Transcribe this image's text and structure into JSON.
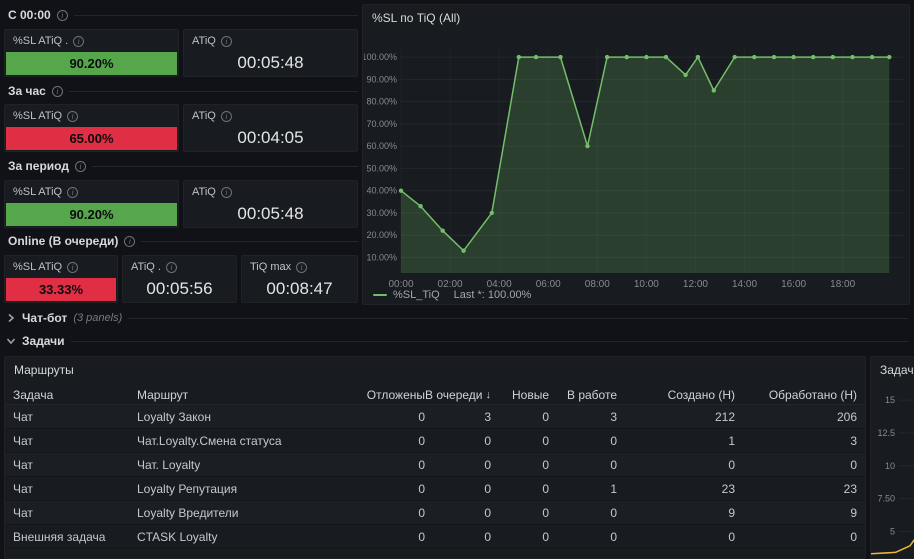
{
  "colors": {
    "green": "#56A64B",
    "red": "#E02F44",
    "chart_green": "#73BF69",
    "yellow": "#EAB839"
  },
  "sections": [
    {
      "label": "С 00:00",
      "panels": [
        {
          "title": "%SL ATiQ .",
          "value": "90.20%",
          "kind": "bar",
          "color": "green"
        },
        {
          "title": "ATiQ",
          "value": "00:05:48",
          "kind": "time"
        }
      ]
    },
    {
      "label": "За час",
      "panels": [
        {
          "title": "%SL ATiQ",
          "value": "65.00%",
          "kind": "bar",
          "color": "red"
        },
        {
          "title": "ATiQ",
          "value": "00:04:05",
          "kind": "time"
        }
      ]
    },
    {
      "label": "За период",
      "panels": [
        {
          "title": "%SL ATiQ",
          "value": "90.20%",
          "kind": "bar",
          "color": "green"
        },
        {
          "title": "ATiQ",
          "value": "00:05:48",
          "kind": "time"
        }
      ]
    },
    {
      "label": "Online (В очереди)",
      "panels": [
        {
          "title": "%SL ATiQ",
          "value": "33.33%",
          "kind": "bar",
          "color": "red"
        },
        {
          "title": "ATiQ .",
          "value": "00:05:56",
          "kind": "time"
        },
        {
          "title": "TiQ max",
          "value": "00:08:47",
          "kind": "time"
        }
      ]
    }
  ],
  "rows": {
    "chatbot": {
      "label": "Чат-бот",
      "meta": "(3 panels)"
    },
    "tasks": {
      "label": "Задачи"
    }
  },
  "table": {
    "title": "Маршруты",
    "columns": [
      "Задача",
      "Маршрут",
      "Отложены",
      "В очереди",
      "Новые",
      "В работе",
      "Создано (H)",
      "Обработано (H)"
    ],
    "sorted_column": "В очереди",
    "sort_direction": "desc",
    "sort_icon": "↓",
    "rows": [
      [
        "Чат",
        "Loyalty Закон",
        "0",
        "3",
        "0",
        "3",
        "212",
        "206"
      ],
      [
        "Чат",
        "Чат.Loyalty.Смена статуса",
        "0",
        "0",
        "0",
        "0",
        "1",
        "3"
      ],
      [
        "Чат",
        "Чат. Loyalty",
        "0",
        "0",
        "0",
        "0",
        "0",
        "0"
      ],
      [
        "Чат",
        "Loyalty Репутация",
        "0",
        "0",
        "0",
        "1",
        "23",
        "23"
      ],
      [
        "Чат",
        "Loyalty Вредители",
        "0",
        "0",
        "0",
        "0",
        "9",
        "9"
      ],
      [
        "Внешняя задача",
        "CTASK Loyalty",
        "0",
        "0",
        "0",
        "0",
        "0",
        "0"
      ]
    ]
  },
  "chart_data": [
    {
      "type": "area",
      "title": "%SL по TiQ (All)",
      "ylabel": "%SL_TiQ",
      "color_key": "chart_green",
      "xlim": [
        0,
        20.5
      ],
      "ylim": [
        3,
        105
      ],
      "grid": true,
      "legend": {
        "label": "%SL_TiQ",
        "value": "Last *: 100.00%",
        "position": "bottom"
      },
      "y_ticks": [
        {
          "v": 100,
          "label": "100.00%"
        },
        {
          "v": 90,
          "label": "90.00%"
        },
        {
          "v": 80,
          "label": "80.00%"
        },
        {
          "v": 70,
          "label": "70.00%"
        },
        {
          "v": 60,
          "label": "60.00%"
        },
        {
          "v": 50,
          "label": "50.00%"
        },
        {
          "v": 40,
          "label": "40.00%"
        },
        {
          "v": 30,
          "label": "30.00%"
        },
        {
          "v": 20,
          "label": "20.00%"
        },
        {
          "v": 10,
          "label": "10.00%"
        }
      ],
      "x_ticks": [
        {
          "h": 0,
          "label": "00:00"
        },
        {
          "h": 2,
          "label": "02:00"
        },
        {
          "h": 4,
          "label": "04:00"
        },
        {
          "h": 6,
          "label": "06:00"
        },
        {
          "h": 8,
          "label": "08:00"
        },
        {
          "h": 10,
          "label": "10:00"
        },
        {
          "h": 12,
          "label": "12:00"
        },
        {
          "h": 14,
          "label": "14:00"
        },
        {
          "h": 16,
          "label": "16:00"
        },
        {
          "h": 18,
          "label": "18:00"
        }
      ],
      "points": [
        [
          0,
          40
        ],
        [
          0.8,
          33
        ],
        [
          1.7,
          22
        ],
        [
          2.55,
          13
        ],
        [
          3.7,
          30
        ],
        [
          4.8,
          100
        ],
        [
          5.5,
          100
        ],
        [
          6.5,
          100
        ],
        [
          7.6,
          60
        ],
        [
          8.4,
          100
        ],
        [
          9.2,
          100
        ],
        [
          10,
          100
        ],
        [
          10.8,
          100
        ],
        [
          11.6,
          92
        ],
        [
          12.1,
          100
        ],
        [
          12.75,
          85
        ],
        [
          13.6,
          100
        ],
        [
          14.4,
          100
        ],
        [
          15.2,
          100
        ],
        [
          16,
          100
        ],
        [
          16.8,
          100
        ],
        [
          17.6,
          100
        ],
        [
          18.4,
          100
        ],
        [
          19.2,
          100
        ],
        [
          19.9,
          100
        ]
      ]
    },
    {
      "type": "line",
      "title": "Задачи (All",
      "color_key": "yellow",
      "ylim": [
        3.2,
        16
      ],
      "grid": true,
      "y_ticks": [
        {
          "v": 15,
          "label": "15"
        },
        {
          "v": 12.5,
          "label": "12.5"
        },
        {
          "v": 10,
          "label": "10"
        },
        {
          "v": 7.5,
          "label": "7.50"
        },
        {
          "v": 5,
          "label": "5"
        }
      ],
      "points": [
        [
          0,
          3.3
        ],
        [
          0.1,
          3.4
        ],
        [
          0.16,
          3.9
        ],
        [
          0.26,
          6.5
        ],
        [
          0.5,
          8.0
        ]
      ]
    }
  ]
}
